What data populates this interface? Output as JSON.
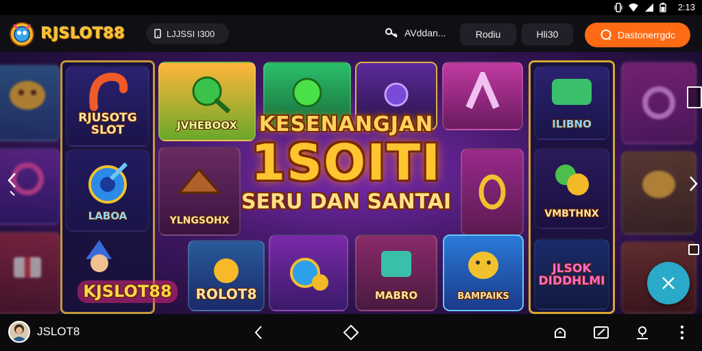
{
  "status": {
    "time": "2:13"
  },
  "header": {
    "brand": "RJSLOT88",
    "phone_pill": "LJJSSI I300",
    "username": "AVddan...",
    "login_label": "Rodiu",
    "register_label": "Hli30",
    "contact_label": "Dastonerrgdc"
  },
  "banner": {
    "line1": "KESENANGJAN",
    "line2": "1SOITI",
    "line3": "SERU DAN SANTAI"
  },
  "tiles": {
    "t1": "RJUSOTG SLOT",
    "t2": "LABOA",
    "t3": "KJSLOT88",
    "t4": "JVHEBOOX",
    "t5": "YLNGSOHX",
    "t6": "ROLOT8",
    "t7": "MABRO",
    "t8": "BAMPAIKS",
    "t9": "ILIBNO",
    "t10": "VMBTHNX",
    "t11": "JLSOK DIDDHLMI"
  },
  "footer": {
    "account_name": "JSLOT8"
  },
  "colors": {
    "accent": "#ff6a14",
    "brand_gold": "#f7c531",
    "fab": "#2aa9c9"
  }
}
